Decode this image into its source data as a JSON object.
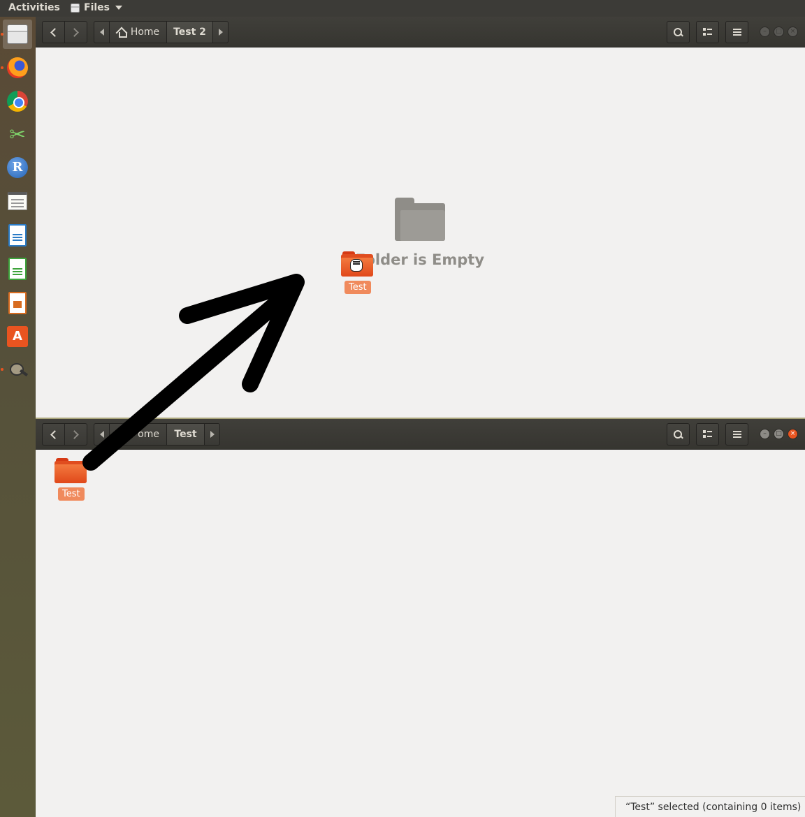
{
  "topbar": {
    "activities": "Activities",
    "app_menu": "Files"
  },
  "dock": {
    "items": [
      {
        "name": "files",
        "icon": "files-icon",
        "active": true
      },
      {
        "name": "firefox",
        "icon": "firefox-icon"
      },
      {
        "name": "chrome",
        "icon": "chrome-icon"
      },
      {
        "name": "inkscape-like tool",
        "icon": "tool-icon"
      },
      {
        "name": "rstudio",
        "icon": "r-icon",
        "glyph": "R"
      },
      {
        "name": "text editor",
        "icon": "text-editor-icon"
      },
      {
        "name": "writer",
        "icon": "libreoffice-writer-icon"
      },
      {
        "name": "calc",
        "icon": "libreoffice-calc-icon"
      },
      {
        "name": "impress",
        "icon": "libreoffice-impress-icon"
      },
      {
        "name": "software",
        "icon": "ubuntu-software-icon",
        "glyph": "A"
      },
      {
        "name": "gimp",
        "icon": "gimp-icon"
      }
    ]
  },
  "window_top": {
    "path_home": "Home",
    "path_current": "Test 2",
    "empty_message": "Folder is Empty",
    "dragged_item_label": "Test"
  },
  "window_bottom": {
    "path_home": "ome",
    "path_current": "Test",
    "item_label": "Test",
    "status": "“Test” selected  (containing 0 items)"
  },
  "colors": {
    "accent": "#e95420",
    "folder": "#e04d1f",
    "headerbar": "#3a3935",
    "content_bg": "#f2f1f0"
  }
}
